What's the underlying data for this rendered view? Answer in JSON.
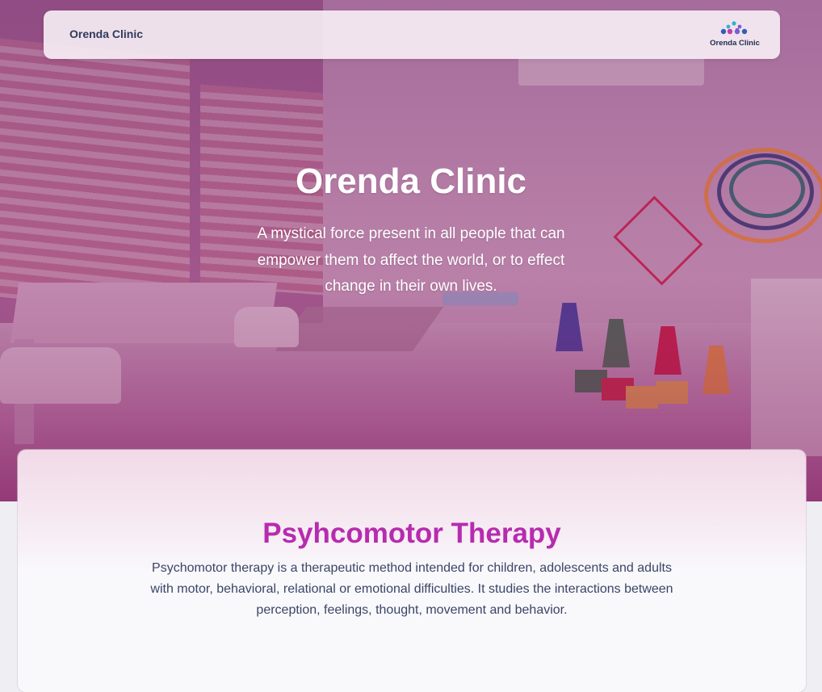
{
  "navbar": {
    "brand": "Orenda Clinic",
    "logo_text": "Orenda Clinic",
    "logo_colors": [
      "#2bb6c9",
      "#7a5fcf",
      "#c43fa6",
      "#2f5fb8"
    ]
  },
  "hero": {
    "title": "Orenda Clinic",
    "subtitle": "A mystical force present in all people that can empower them to affect the world, or to effect change in their own lives."
  },
  "section": {
    "title": "Psyhcomotor Therapy",
    "description": "Psychomotor therapy is a therapeutic method intended for children, adolescents and adults with motor, behavioral, relational or emotional difficulties. It studies the interactions between perception, feelings, thought, movement and behavior."
  },
  "colors": {
    "accent": "#b72bb0",
    "nav_text": "#2f3a5c",
    "body_text": "#3a4567"
  }
}
